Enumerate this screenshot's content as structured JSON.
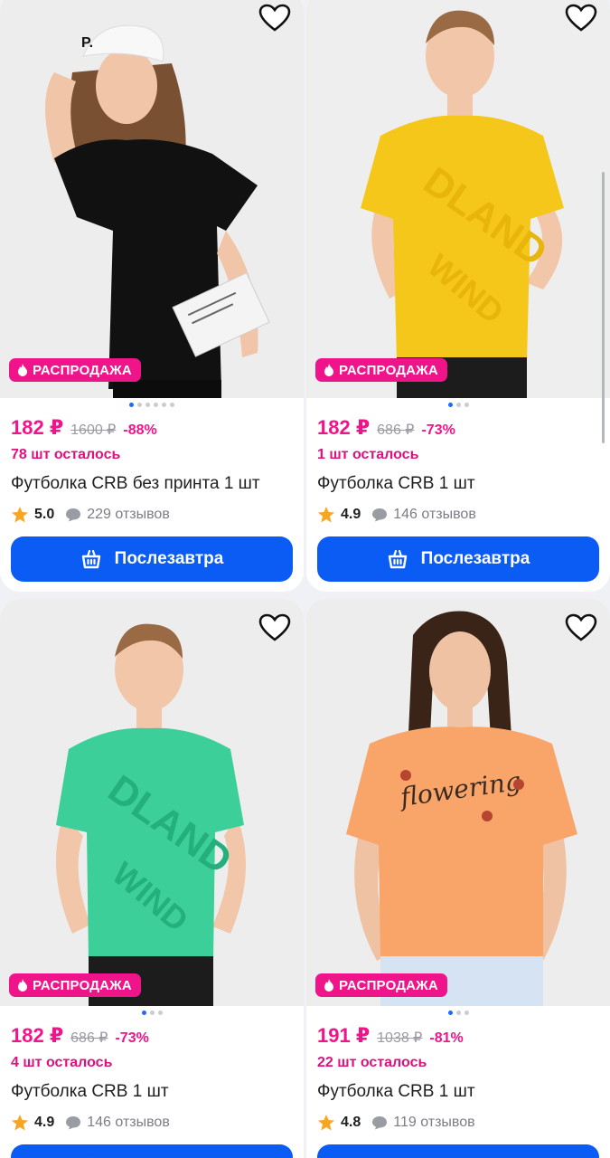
{
  "sale_badge": "РАСПРОДАЖА",
  "buy_button_label": "Послезавтра",
  "accent_pink": "#f0148a",
  "accent_blue": "#0a5cf5",
  "products": [
    {
      "price": "182 ₽",
      "old_price": "1600 ₽",
      "discount": "-88%",
      "stock": "78 шт осталось",
      "title": "Футболка CRB без принта 1 шт",
      "rating": "5.0",
      "reviews": "229 отзывов",
      "shirt_color": "black",
      "image_dots": 6
    },
    {
      "price": "182 ₽",
      "old_price": "686 ₽",
      "discount": "-73%",
      "stock": "1 шт осталось",
      "title": "Футболка CRB 1 шт",
      "rating": "4.9",
      "reviews": "146 отзывов",
      "shirt_color": "yellow",
      "image_dots": 3
    },
    {
      "price": "182 ₽",
      "old_price": "686 ₽",
      "discount": "-73%",
      "stock": "4 шт осталось",
      "title": "Футболка CRB 1 шт",
      "rating": "4.9",
      "reviews": "146 отзывов",
      "shirt_color": "green",
      "image_dots": 3
    },
    {
      "price": "191 ₽",
      "old_price": "1038 ₽",
      "discount": "-81%",
      "stock": "22 шт осталось",
      "title": "Футболка CRB 1 шт",
      "rating": "4.8",
      "reviews": "119 отзывов",
      "shirt_color": "orange",
      "image_dots": 3
    }
  ]
}
